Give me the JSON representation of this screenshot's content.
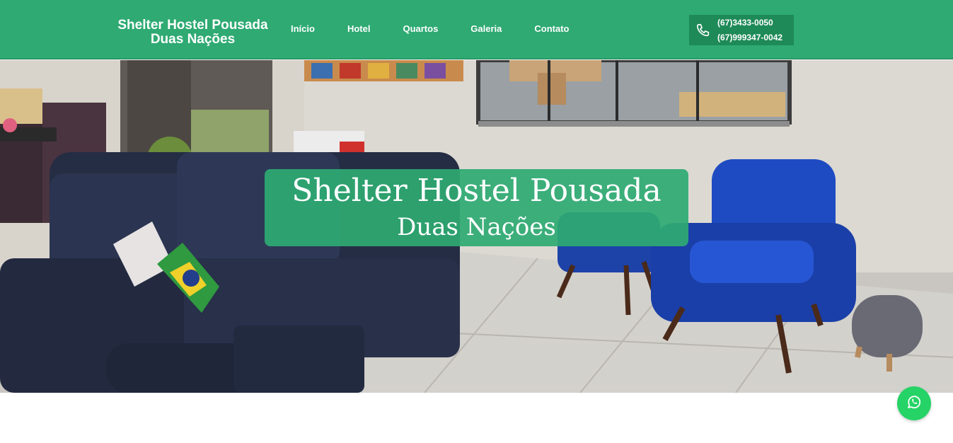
{
  "header": {
    "brand_line1": "Shelter Hostel Pousada",
    "brand_line2": "Duas Nações",
    "nav": [
      {
        "label": "Início"
      },
      {
        "label": "Hotel"
      },
      {
        "label": "Quartos"
      },
      {
        "label": "Galeria"
      },
      {
        "label": "Contato"
      }
    ],
    "phones": [
      "(67)3433-0050",
      "(67)999347-0042"
    ],
    "phone_icon": "phone-icon"
  },
  "hero": {
    "title": "Shelter Hostel Pousada",
    "subtitle": "Duas Nações",
    "photo": "living-room-photo"
  },
  "floating": {
    "whatsapp_icon": "whatsapp-icon"
  },
  "colors": {
    "brand_green": "#2eaa72",
    "phone_box": "#1e8a57",
    "whatsapp": "#25d366"
  }
}
